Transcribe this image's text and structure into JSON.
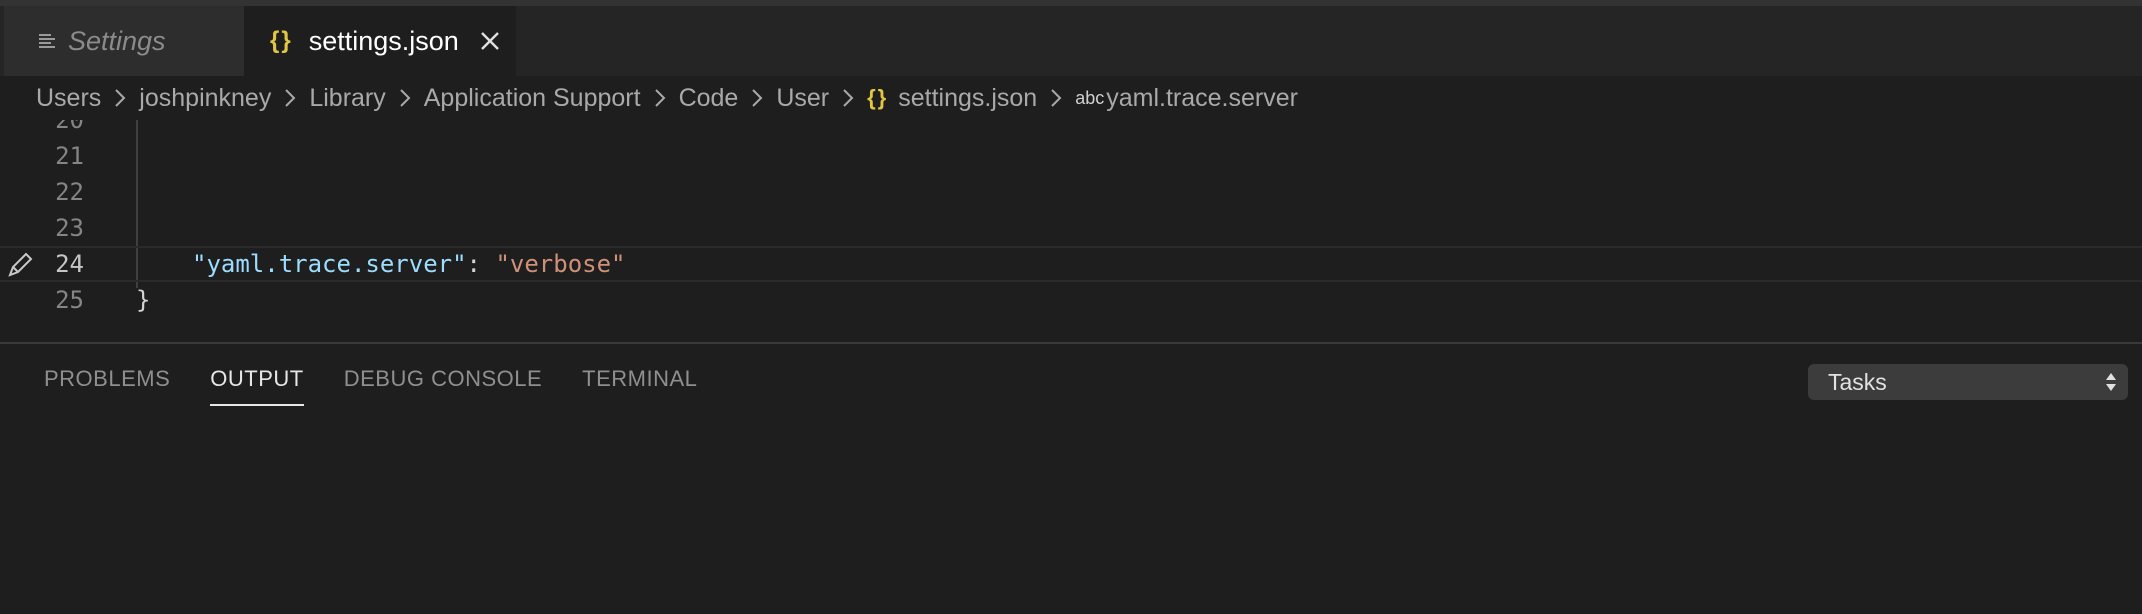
{
  "tabs": [
    {
      "label": "Settings",
      "icon": "menu-lines-icon",
      "active": false
    },
    {
      "label": "settings.json",
      "icon": "braces-icon",
      "active": true
    }
  ],
  "breadcrumb": {
    "items": [
      "Users",
      "joshpinkney",
      "Library",
      "Application Support",
      "Code",
      "User"
    ],
    "file": "settings.json",
    "symbol_prefix": "abc",
    "symbol": "yaml.trace.server"
  },
  "editor": {
    "partial_line_number": "20",
    "lines": [
      {
        "number": "21",
        "key": "",
        "colon": "",
        "value": "",
        "brace": ""
      },
      {
        "number": "22",
        "key": "",
        "colon": "",
        "value": "",
        "brace": ""
      },
      {
        "number": "23",
        "key": "",
        "colon": "",
        "value": "",
        "brace": ""
      },
      {
        "number": "24",
        "key": "\"yaml.trace.server\"",
        "colon": ": ",
        "value": "\"verbose\"",
        "brace": ""
      },
      {
        "number": "25",
        "key": "",
        "colon": "",
        "value": "",
        "brace": "}"
      }
    ]
  },
  "panel": {
    "tabs": [
      "PROBLEMS",
      "OUTPUT",
      "DEBUG CONSOLE",
      "TERMINAL"
    ],
    "active_tab": "OUTPUT",
    "task_select_value": "Tasks"
  },
  "colors": {
    "background": "#1e1e1e",
    "json_key": "#9cdcfe",
    "json_string": "#ce9178",
    "braces_icon": "#e2c541"
  }
}
